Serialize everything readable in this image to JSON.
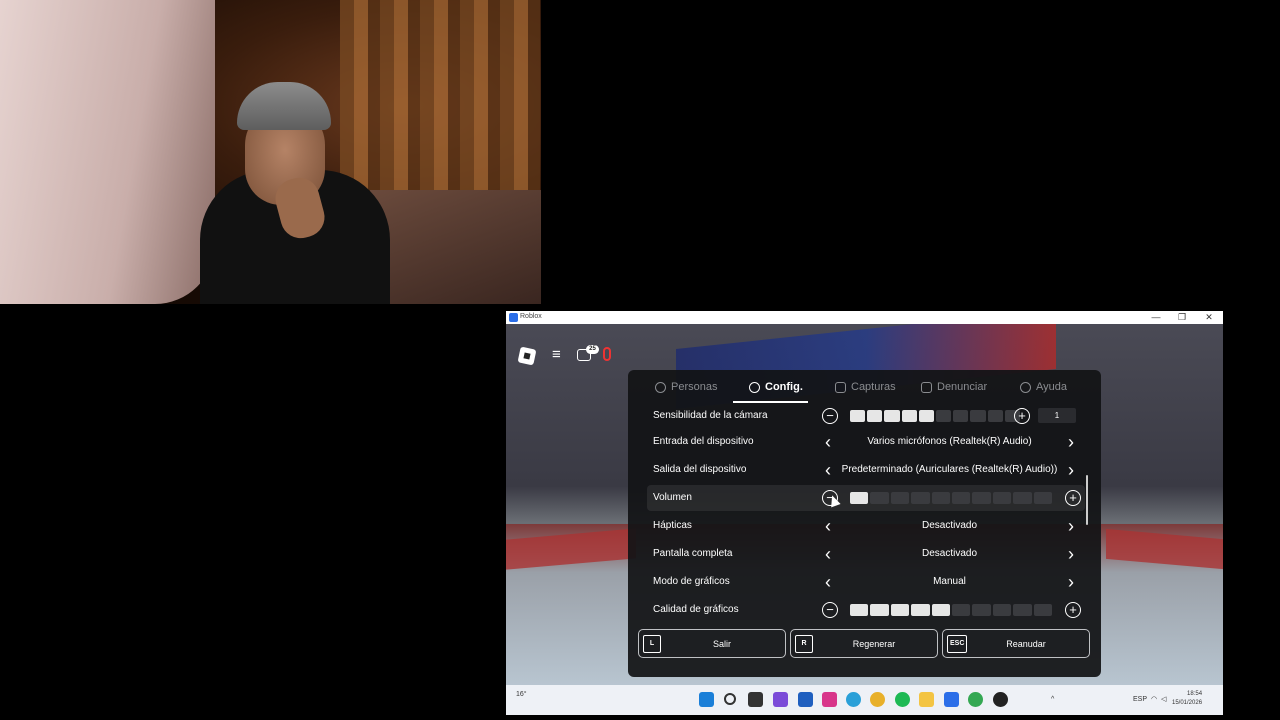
{
  "window": {
    "title": "Roblox",
    "minimize": "—",
    "maximize": "❐",
    "close": "✕"
  },
  "hud": {
    "chat_badge": "25"
  },
  "tabs": [
    {
      "label": "Personas",
      "icon": "people-icon"
    },
    {
      "label": "Config.",
      "icon": "gear-icon",
      "active": true
    },
    {
      "label": "Capturas",
      "icon": "camera-icon"
    },
    {
      "label": "Denunciar",
      "icon": "flag-icon"
    },
    {
      "label": "Ayuda",
      "icon": "help-icon"
    }
  ],
  "settings": {
    "camera_sensitivity": {
      "label": "Sensibilidad de la cámara",
      "value": "1",
      "level": 5,
      "steps": 10
    },
    "input_device": {
      "label": "Entrada del dispositivo",
      "value": "Varios micrófonos (Realtek(R) Audio)"
    },
    "output_device": {
      "label": "Salida del dispositivo",
      "value": "Predeterminado (Auriculares (Realtek(R) Audio))"
    },
    "volume": {
      "label": "Volumen",
      "level": 1,
      "steps": 10
    },
    "haptics": {
      "label": "Hápticas",
      "value": "Desactivado"
    },
    "fullscreen": {
      "label": "Pantalla completa",
      "value": "Desactivado"
    },
    "graphics_mode": {
      "label": "Modo de gráficos",
      "value": "Manual"
    },
    "graphics_quality": {
      "label": "Calidad de gráficos",
      "level": 5,
      "steps": 10
    }
  },
  "footer": {
    "leave": {
      "key": "L",
      "label": "Salir"
    },
    "reset": {
      "key": "R",
      "label": "Regenerar"
    },
    "resume": {
      "key": "ESC",
      "label": "Reanudar"
    }
  },
  "taskbar": {
    "weather": "16°",
    "language": "ESP",
    "time": "18:54",
    "date": "15/01/2026"
  }
}
